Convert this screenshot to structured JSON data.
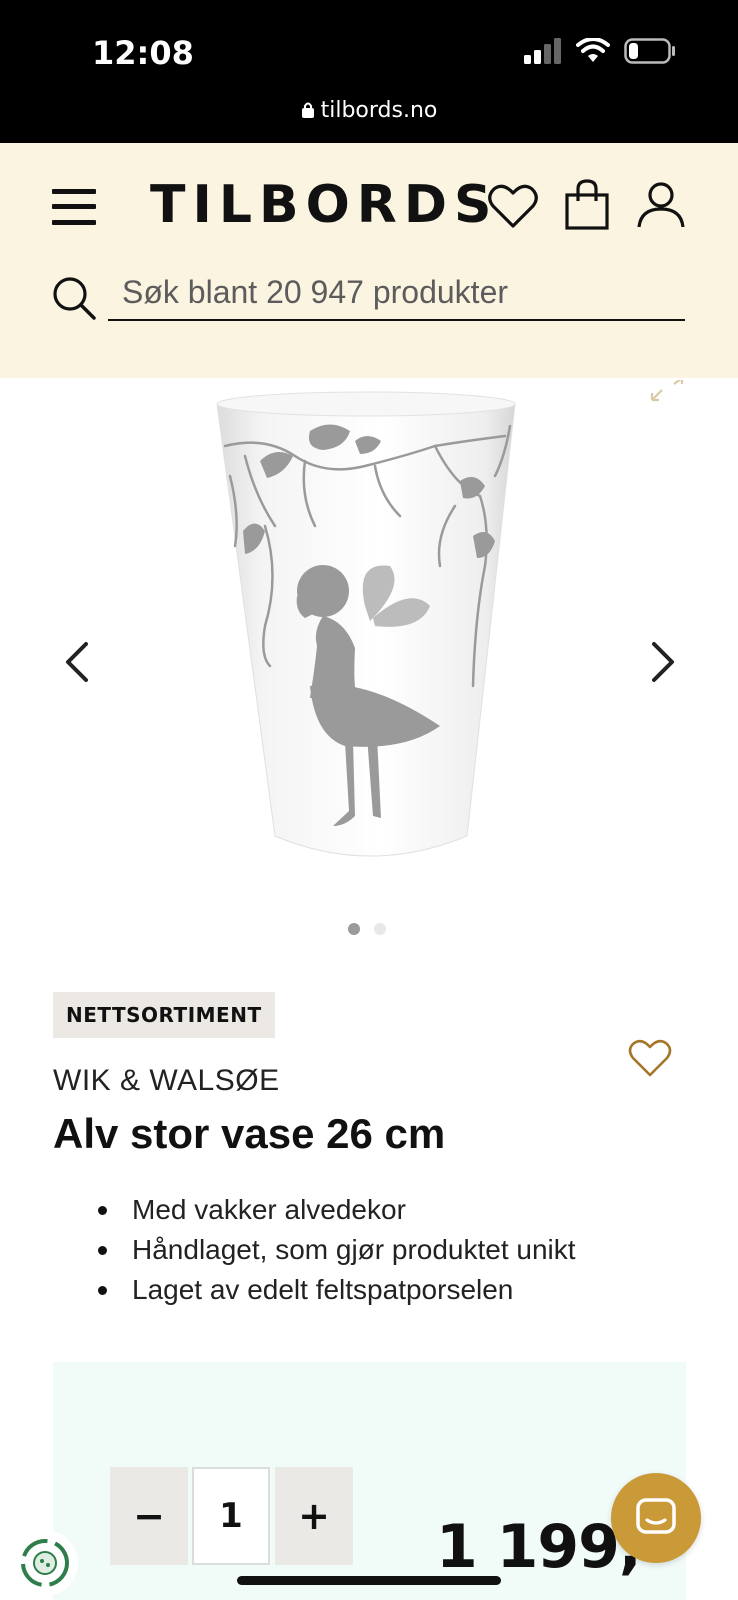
{
  "status_bar": {
    "time": "12:08",
    "url": "tilbords.no"
  },
  "header": {
    "logo": "TILBORDS",
    "search_placeholder": "Søk blant 20 947 produkter",
    "background": "#fbf4e1"
  },
  "gallery": {
    "image_count": 2,
    "active_index": 0
  },
  "product": {
    "badge": "NETTSORTIMENT",
    "brand": "WIK & WALSØE",
    "title": "Alv stor vase 26 cm",
    "features": [
      "Med vakker alvedekor",
      "Håndlaget, som gjør produktet unikt",
      "Laget av edelt feltspatporselen"
    ]
  },
  "purchase": {
    "quantity": "1",
    "decrease_label": "−",
    "increase_label": "+",
    "price": "1 199,-",
    "panel_color": "#f1fbf8"
  },
  "colors": {
    "accent_gold": "#c99a37",
    "heart_gold": "#a5762a"
  },
  "icons": [
    "menu-icon",
    "heart-icon",
    "shopping-bag-icon",
    "user-icon",
    "search-icon",
    "chevron-left-icon",
    "chevron-right-icon",
    "expand-icon",
    "chat-icon",
    "eco-badge-icon"
  ]
}
